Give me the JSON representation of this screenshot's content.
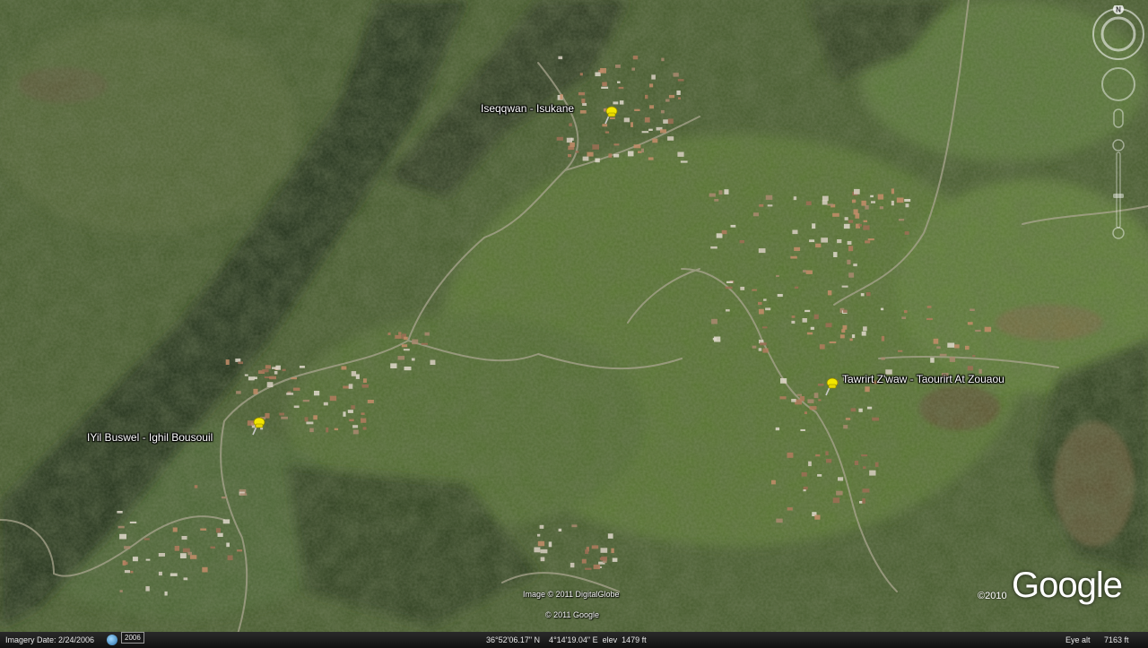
{
  "placemarks": [
    {
      "label": "Iseqqwan - Isukane"
    },
    {
      "label": "Tawrirt Z'waw - Taourirt At Zouaou"
    },
    {
      "label": "IYil Buswel - Ighil Bousouil"
    }
  ],
  "attribution": {
    "imagery": "Image © 2011 DigitalGlobe",
    "google": "© 2011 Google",
    "copyright_year": "©2010",
    "logo": "Google"
  },
  "status_bar": {
    "imagery_date": "Imagery Date: 2/24/2006",
    "history_year": "2006",
    "coords": "36°52'06.17\" N    4°14'19.04\" E  elev  1479 ft",
    "eye_alt_label": "Eye alt",
    "eye_alt_value": "7163 ft"
  },
  "compass": {
    "north_label": "N"
  },
  "icons": {
    "pin": "pushpin-icon",
    "history": "historical-imagery-icon",
    "compass": "compass-icon",
    "look": "look-joystick-icon",
    "move": "move-joystick-icon",
    "zoom": "zoom-slider-icon"
  },
  "colors": {
    "pin": "#f2e600",
    "label": "#ffffff",
    "terrain_dark": "#2f3d22",
    "terrain_green": "#4e6a2f"
  }
}
